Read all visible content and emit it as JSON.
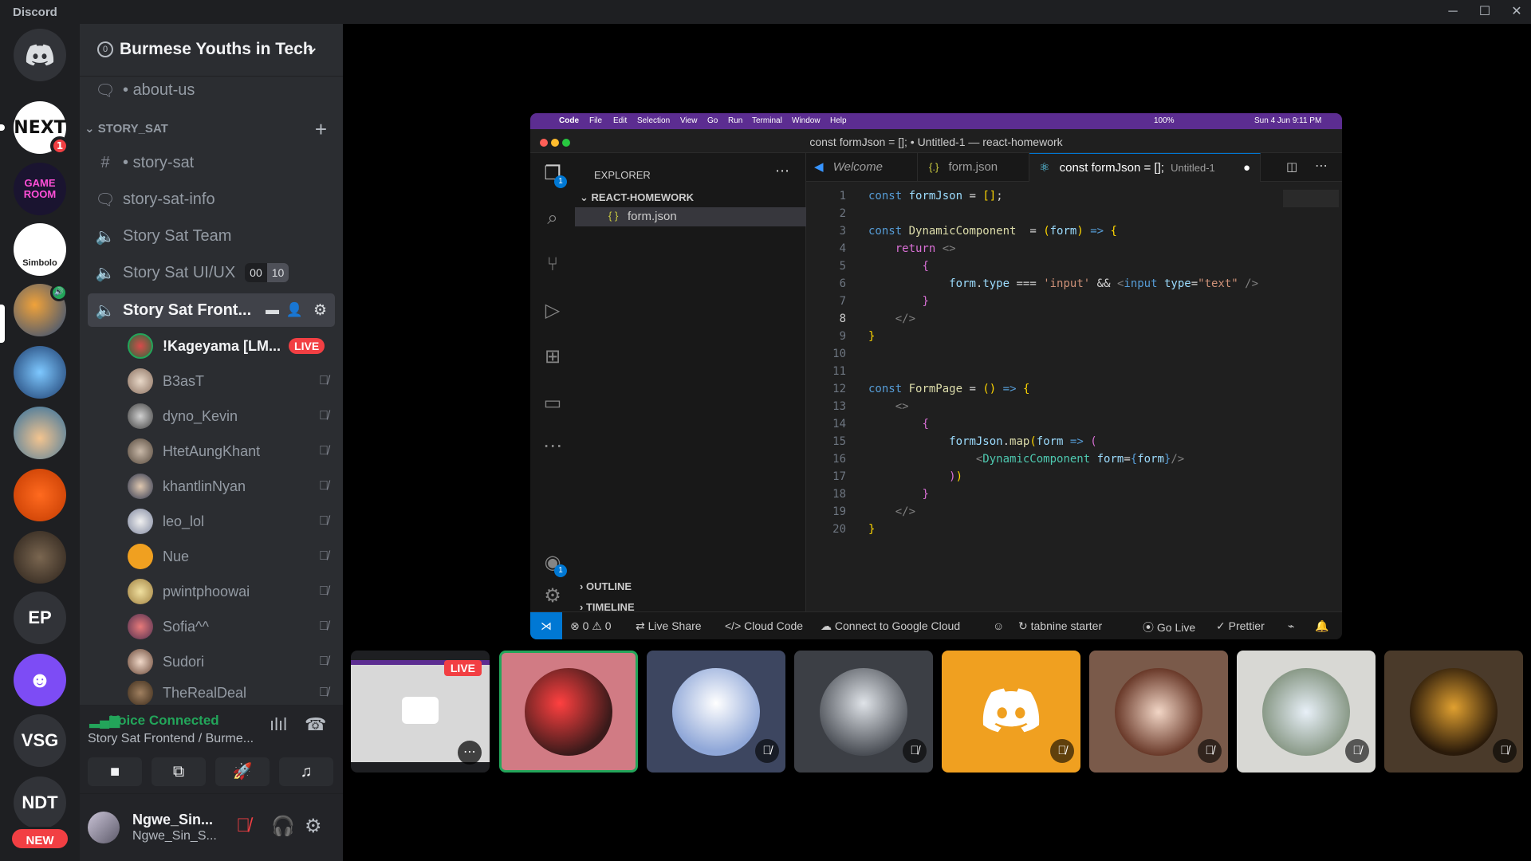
{
  "window": {
    "app_title": "Discord",
    "controls": {
      "minimize": "─",
      "maximize": "☐",
      "close": "✕"
    }
  },
  "servers": [
    {
      "name": "home",
      "label": ""
    },
    {
      "name": "NEXT",
      "label": "NEXT",
      "badge": "1"
    },
    {
      "name": "GAME ROOM",
      "label": "GAME ROOM"
    },
    {
      "name": "Simbolo",
      "label": "Simbolo"
    },
    {
      "name": "EP",
      "label": "EP"
    },
    {
      "name": "VSG",
      "label": "VSG"
    },
    {
      "name": "NDT",
      "label": "NDT"
    }
  ],
  "new_badge": "NEW",
  "server_header": {
    "boost": "0",
    "name": "Burmese Youths in Tech",
    "chevron": "⌄"
  },
  "channels": {
    "about_us": "about-us",
    "category": "STORY_SAT",
    "story_sat": "story-sat",
    "story_sat_info": "story-sat-info",
    "team": "Story Sat Team",
    "uiux": "Story Sat UI/UX",
    "uiux_count": "00",
    "uiux_limit": "10",
    "frontend": "Story Sat Front..."
  },
  "voice_users": [
    {
      "name": "!Kageyama [LM...",
      "live": "LIVE"
    },
    {
      "name": "B3asT"
    },
    {
      "name": "dyno_Kevin"
    },
    {
      "name": "HtetAungKhant"
    },
    {
      "name": "khantlinNyan"
    },
    {
      "name": "leo_lol"
    },
    {
      "name": "Nue"
    },
    {
      "name": "pwintphoowai"
    },
    {
      "name": "Sofia^^"
    },
    {
      "name": "Sudori"
    },
    {
      "name": "TheRealDeal"
    }
  ],
  "voice_panel": {
    "status": "Voice Connected",
    "channel": "Story Sat Frontend / Burme..."
  },
  "user_panel": {
    "name": "Ngwe_Sin...",
    "tag": "Ngwe_Sin_S..."
  },
  "vscode": {
    "menubar": [
      "Code",
      "File",
      "Edit",
      "Selection",
      "View",
      "Go",
      "Run",
      "Terminal",
      "Window",
      "Help"
    ],
    "battery": "100%",
    "clock": "Sun 4 Jun  9:11 PM",
    "title": "const formJson = []; • Untitled-1 — react-homework",
    "explorer_title": "EXPLORER",
    "project": "REACT-HOMEWORK",
    "file": "form.json",
    "file_icon": "{ }",
    "outline": "OUTLINE",
    "timeline": "TIMELINE",
    "tabs": [
      {
        "label": "Welcome"
      },
      {
        "label": "form.json"
      },
      {
        "label": "const formJson = [];",
        "hint": "Untitled-1"
      }
    ],
    "line_numbers": [
      "1",
      "2",
      "3",
      "4",
      "5",
      "6",
      "7",
      "8",
      "9",
      "10",
      "11",
      "12",
      "13",
      "14",
      "15",
      "16",
      "17",
      "18",
      "19",
      "20"
    ],
    "status": {
      "problems": "⊗ 0 ⚠ 0",
      "live_share": "Live Share",
      "cloud_code": "Cloud Code",
      "google_cloud": "Connect to Google Cloud",
      "tabnine": "tabnine starter",
      "go_live": "Go Live",
      "prettier": "Prettier"
    }
  },
  "stream_tile": {
    "live": "LIVE"
  },
  "colors": {
    "discord_bg": "#1e1f22",
    "sidebar": "#2b2d31",
    "green": "#23a55a",
    "red": "#f23f43",
    "blurple": "#5865f2",
    "vscode_menu": "#5c2d91"
  }
}
